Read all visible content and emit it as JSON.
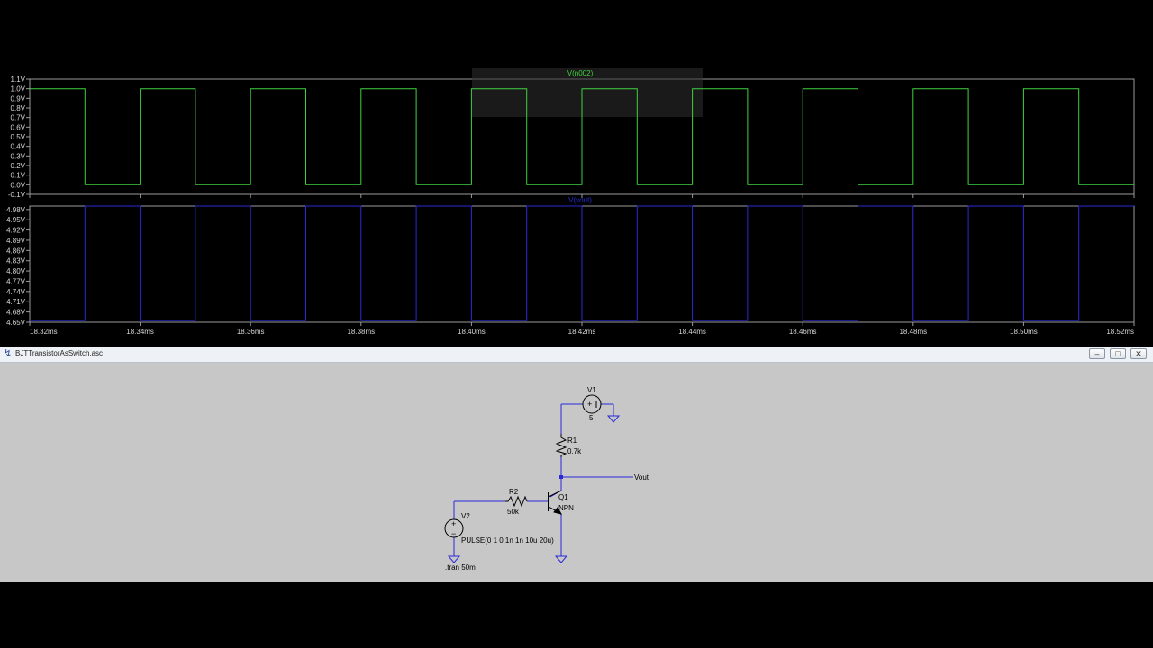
{
  "waveform": {
    "top_pane": {
      "trace_label": "V(n002)",
      "trace_color": "#3fd13f",
      "y_ticks": [
        "1.1V",
        "1.0V",
        "0.9V",
        "0.8V",
        "0.7V",
        "0.6V",
        "0.5V",
        "0.4V",
        "0.3V",
        "0.2V",
        "0.1V",
        "0.0V",
        "-0.1V"
      ],
      "y_values": [
        1.1,
        1.0,
        0.9,
        0.8,
        0.7,
        0.6,
        0.5,
        0.4,
        0.3,
        0.2,
        0.1,
        0.0,
        -0.1
      ],
      "ylim": [
        -0.1,
        1.1
      ],
      "high": 1.0,
      "low": 0.0
    },
    "bottom_pane": {
      "trace_label": "V(vout)",
      "trace_color": "#2a2ad8",
      "y_ticks": [
        "4.98V",
        "4.95V",
        "4.92V",
        "4.89V",
        "4.86V",
        "4.83V",
        "4.80V",
        "4.77V",
        "4.74V",
        "4.71V",
        "4.68V",
        "4.65V"
      ],
      "y_values": [
        4.98,
        4.95,
        4.92,
        4.89,
        4.86,
        4.83,
        4.8,
        4.77,
        4.74,
        4.71,
        4.68,
        4.65
      ],
      "ylim": [
        4.65,
        4.99
      ],
      "high": 4.99,
      "low": 4.655
    },
    "x_ticks": [
      "18.32ms",
      "18.34ms",
      "18.36ms",
      "18.38ms",
      "18.40ms",
      "18.42ms",
      "18.44ms",
      "18.46ms",
      "18.48ms",
      "18.50ms",
      "18.52ms"
    ],
    "x_values": [
      18.32,
      18.34,
      18.36,
      18.38,
      18.4,
      18.42,
      18.44,
      18.46,
      18.48,
      18.5,
      18.52
    ],
    "xlim": [
      18.32,
      18.52
    ],
    "pulse_period_ms": 0.02,
    "pulse_width_ms": 0.01
  },
  "chart_data": [
    {
      "type": "line",
      "series": [
        {
          "name": "V(n002)",
          "x": [
            18.32,
            18.33,
            18.33,
            18.34,
            18.34,
            18.35,
            18.35,
            18.36,
            18.36,
            18.37,
            18.37,
            18.38,
            18.38,
            18.39,
            18.39,
            18.4,
            18.4,
            18.41,
            18.41,
            18.42,
            18.42,
            18.43,
            18.43,
            18.44,
            18.44,
            18.45,
            18.45,
            18.46,
            18.46,
            18.47,
            18.47,
            18.48,
            18.48,
            18.49,
            18.49,
            18.5,
            18.5,
            18.51,
            18.51,
            18.52
          ],
          "y": [
            1,
            1,
            0,
            0,
            1,
            1,
            0,
            0,
            1,
            1,
            0,
            0,
            1,
            1,
            0,
            0,
            1,
            1,
            0,
            0,
            1,
            1,
            0,
            0,
            1,
            1,
            0,
            0,
            1,
            1,
            0,
            0,
            1,
            1,
            0,
            0,
            1,
            1,
            0,
            0
          ]
        }
      ],
      "ylim": [
        -0.1,
        1.1
      ],
      "xlim": [
        18.32,
        18.52
      ],
      "grid": false
    },
    {
      "type": "line",
      "series": [
        {
          "name": "V(vout)",
          "x": [
            18.32,
            18.33,
            18.33,
            18.34,
            18.34,
            18.35,
            18.35,
            18.36,
            18.36,
            18.37,
            18.37,
            18.38,
            18.38,
            18.39,
            18.39,
            18.4,
            18.4,
            18.41,
            18.41,
            18.42,
            18.42,
            18.43,
            18.43,
            18.44,
            18.44,
            18.45,
            18.45,
            18.46,
            18.46,
            18.47,
            18.47,
            18.48,
            18.48,
            18.49,
            18.49,
            18.5,
            18.5,
            18.51,
            18.51,
            18.52
          ],
          "y": [
            4.655,
            4.655,
            4.99,
            4.99,
            4.655,
            4.655,
            4.99,
            4.99,
            4.655,
            4.655,
            4.99,
            4.99,
            4.655,
            4.655,
            4.99,
            4.99,
            4.655,
            4.655,
            4.99,
            4.99,
            4.655,
            4.655,
            4.99,
            4.99,
            4.655,
            4.655,
            4.99,
            4.99,
            4.655,
            4.655,
            4.99,
            4.99,
            4.655,
            4.655,
            4.99,
            4.99,
            4.655,
            4.655,
            4.99,
            4.99
          ]
        }
      ],
      "ylim": [
        4.65,
        4.99
      ],
      "xlim": [
        18.32,
        18.52
      ],
      "grid": false
    }
  ],
  "schematic_window": {
    "title": "BJTTransistorAsSwitch.asc",
    "min_glyph": "–",
    "max_glyph": "□",
    "close_glyph": "✕",
    "app_icon_glyph": "↯",
    "wire_color": "#2a2ad8",
    "v1_name": "V1",
    "v1_value": "5",
    "r1_name": "R1",
    "r1_value": "0.7k",
    "vout_label": "Vout",
    "r2_name": "R2",
    "r2_value": "50k",
    "q1_name": "Q1",
    "q1_model": "NPN",
    "v2_name": "V2",
    "v2_value": "PULSE(0 1 0 1n 1n 10u 20u)",
    "directive": ".tran 50m",
    "plus_glyph": "+",
    "minus_glyph": "−"
  }
}
